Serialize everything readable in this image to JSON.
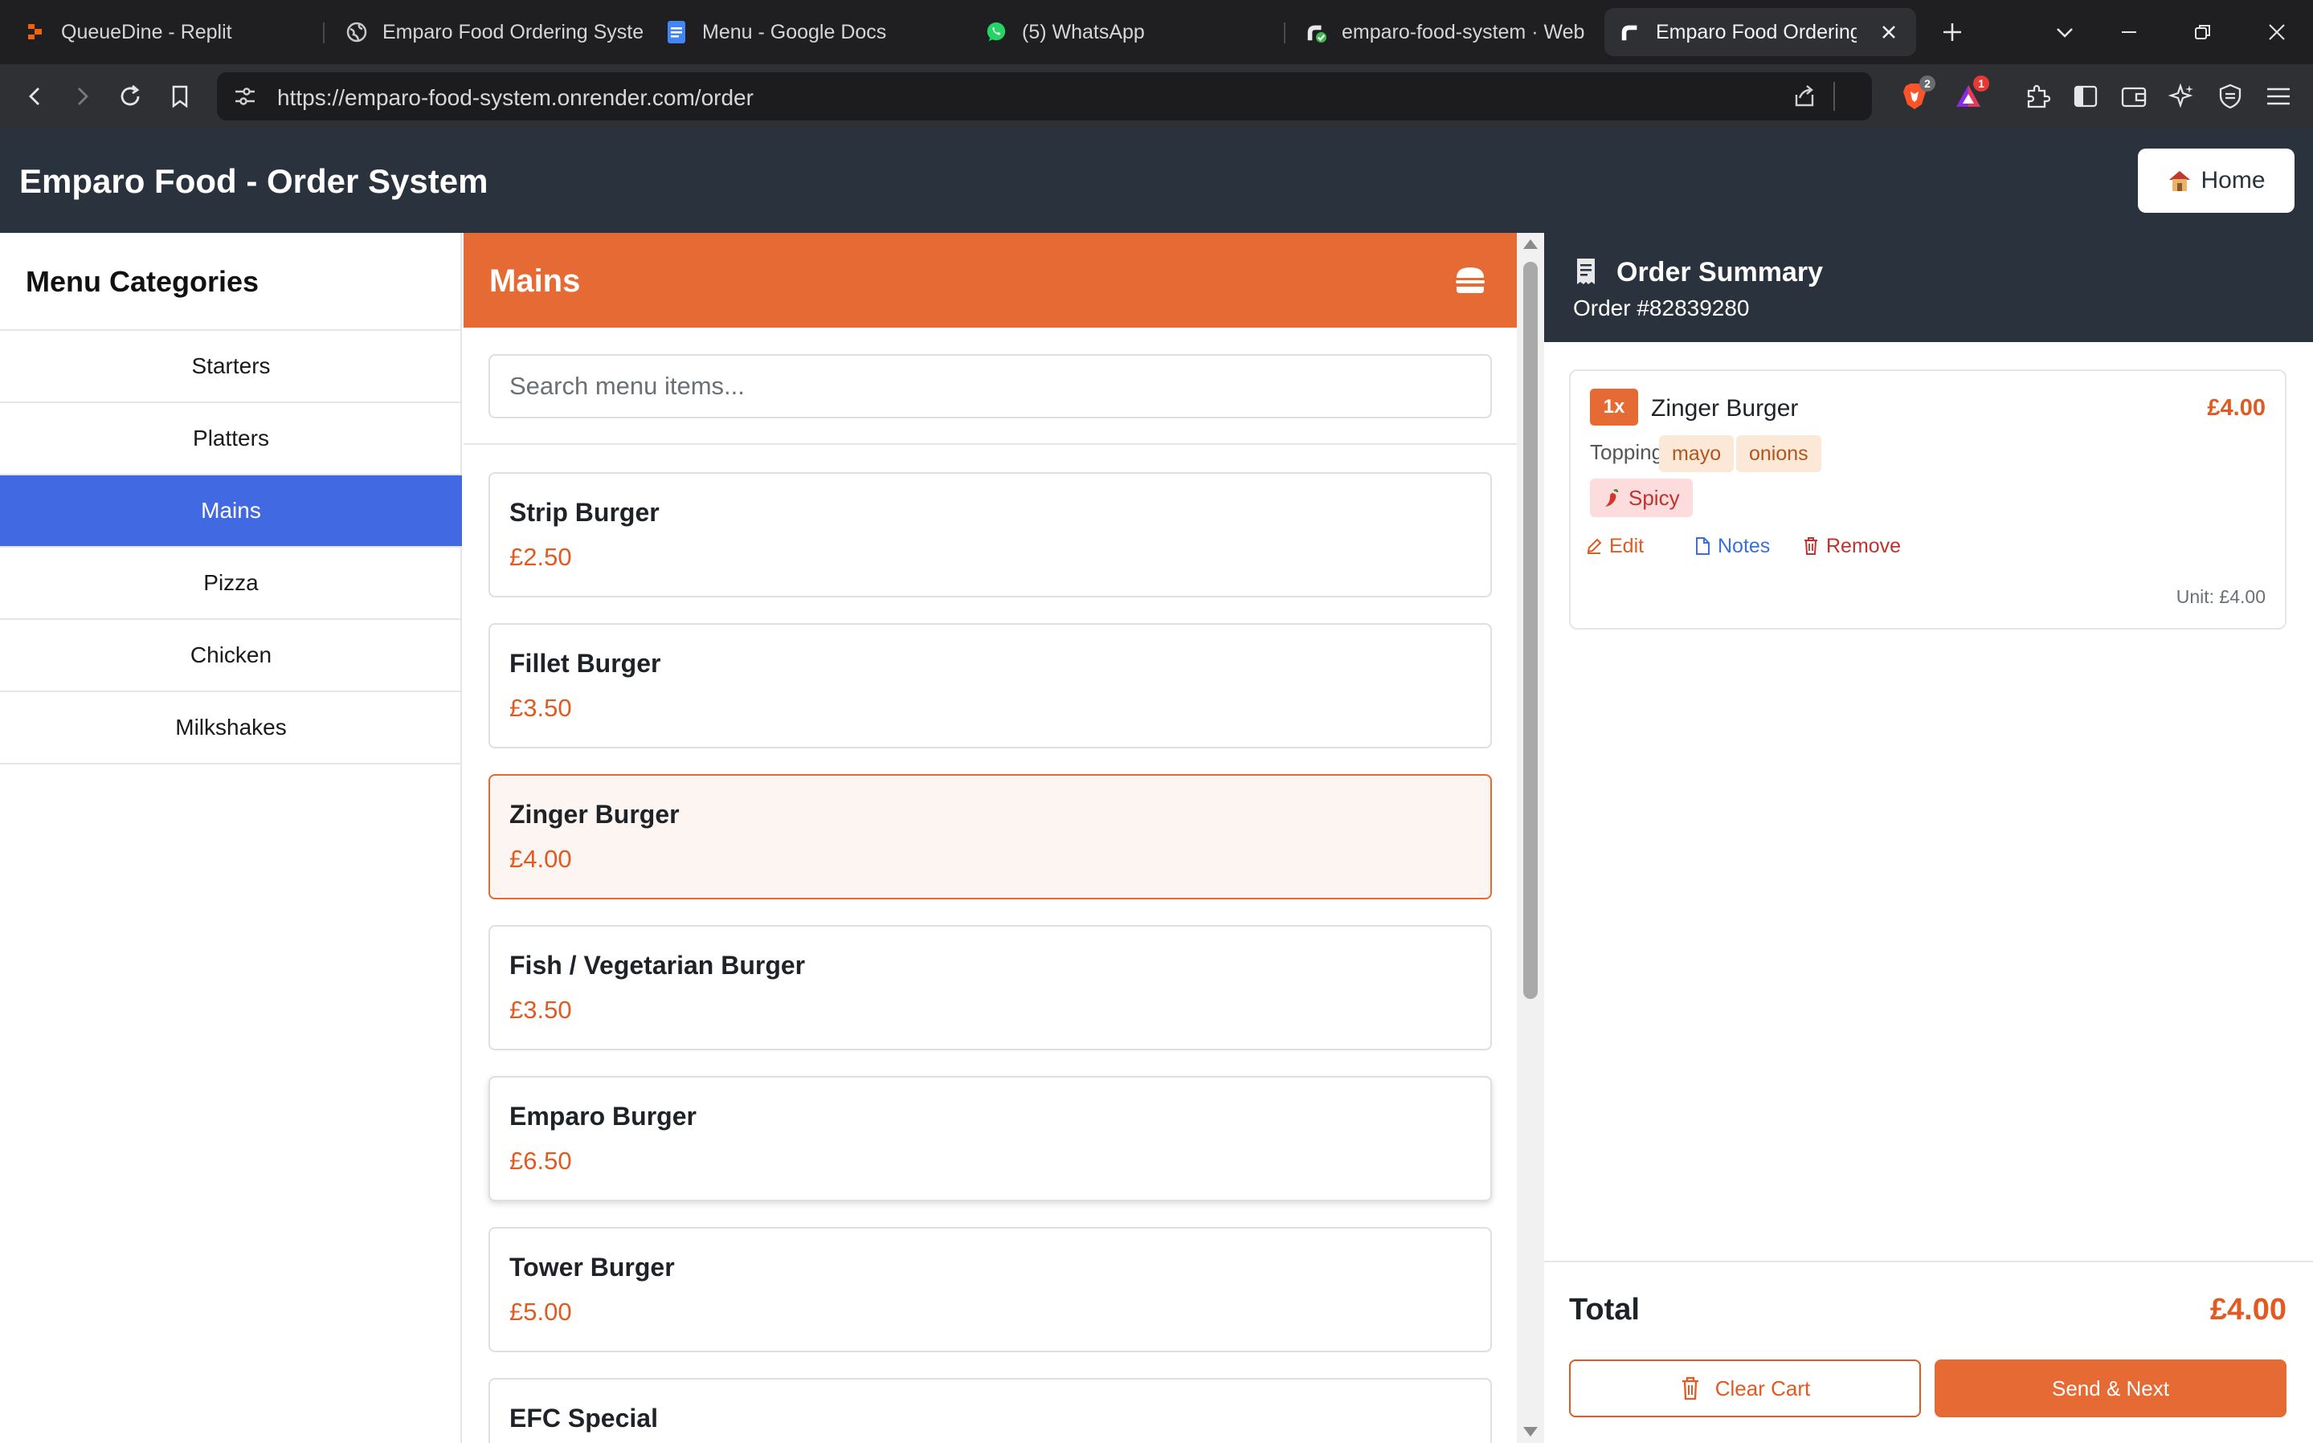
{
  "browser": {
    "tabs": [
      {
        "title": "QueueDine - Replit",
        "icon": "replit-icon"
      },
      {
        "title": "Emparo Food Ordering Syste",
        "icon": "globe-icon"
      },
      {
        "title": "Menu - Google Docs",
        "icon": "google-docs-icon"
      },
      {
        "title": "(5) WhatsApp",
        "icon": "whatsapp-icon"
      },
      {
        "title": "emparo-food-system · Web",
        "icon": "render-icon"
      },
      {
        "title": "Emparo Food Ordering",
        "icon": "render-icon",
        "active": true
      }
    ],
    "url": "https://emparo-food-system.onrender.com/order",
    "shields_badge": "2",
    "alert_badge": "1"
  },
  "header": {
    "title": "Emparo Food - Order System",
    "home_label": "Home",
    "home_icon": "house-icon"
  },
  "sidebar": {
    "title": "Menu Categories",
    "categories": [
      {
        "label": "Starters"
      },
      {
        "label": "Platters"
      },
      {
        "label": "Mains",
        "active": true
      },
      {
        "label": "Pizza"
      },
      {
        "label": "Chicken"
      },
      {
        "label": "Milkshakes"
      }
    ]
  },
  "menu": {
    "category_title": "Mains",
    "category_icon": "burger-icon",
    "search_placeholder": "Search menu items...",
    "items": [
      {
        "name": "Strip Burger",
        "price": "£2.50"
      },
      {
        "name": "Fillet Burger",
        "price": "£3.50"
      },
      {
        "name": "Zinger Burger",
        "price": "£4.00",
        "selected": true
      },
      {
        "name": "Fish / Vegetarian Burger",
        "price": "£3.50"
      },
      {
        "name": "Emparo Burger",
        "price": "£6.50",
        "hovered": true
      },
      {
        "name": "Tower Burger",
        "price": "£5.00"
      },
      {
        "name": "EFC Special",
        "price": ""
      }
    ]
  },
  "order": {
    "title": "Order Summary",
    "number": "Order #82839280",
    "item": {
      "qty": "1x",
      "name": "Zinger Burger",
      "price": "£4.00",
      "toppings_label": "Toppings:",
      "toppings": [
        "mayo",
        "onions"
      ],
      "spice": "Spicy",
      "actions": {
        "edit": "Edit",
        "notes": "Notes",
        "remove": "Remove"
      },
      "unit_price": "Unit: £4.00"
    },
    "total_label": "Total",
    "total_value": "£4.00",
    "clear_label": "Clear Cart",
    "send_label": "Send & Next"
  },
  "colors": {
    "accent": "#e66a33",
    "header_bg": "#2a333d",
    "active_category": "#4169e1",
    "price": "#e05a22"
  }
}
